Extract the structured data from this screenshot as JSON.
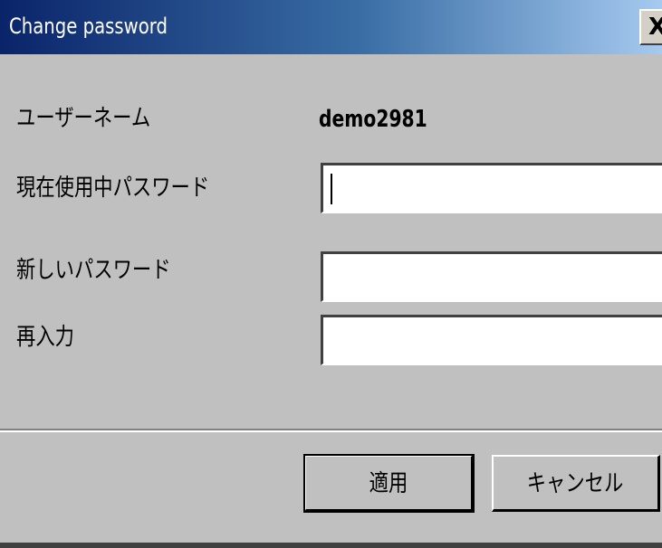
{
  "window": {
    "title": "Change password",
    "close_glyph": "X"
  },
  "form": {
    "username_label": "ユーザーネーム",
    "username_value": "demo2981",
    "current_password_label": "現在使用中パスワード",
    "current_password_value": "",
    "new_password_label": "新しいパスワード",
    "new_password_value": "",
    "confirm_label": "再入力",
    "confirm_value": ""
  },
  "buttons": {
    "apply_label": "適用",
    "cancel_label": "キャンセル"
  },
  "colors": {
    "face": "#c0c0c0",
    "titlebar_start": "#0a246a",
    "titlebar_end": "#a6caf0",
    "title_text": "#ffffff"
  }
}
